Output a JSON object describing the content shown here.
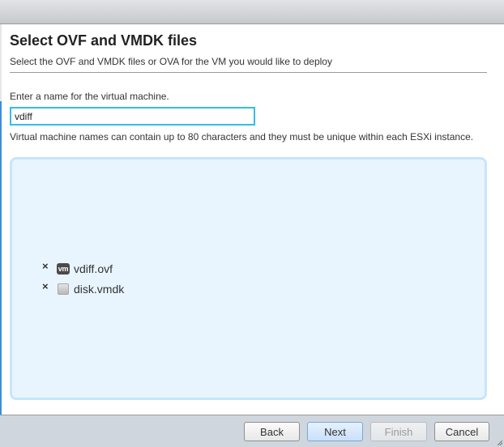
{
  "wizard": {
    "title": "Select OVF and VMDK files",
    "subtitle": "Select the OVF and VMDK files or OVA for the VM you would like to deploy"
  },
  "vm_name": {
    "label": "Enter a name for the virtual machine.",
    "value": "vdiff",
    "help": "Virtual machine names can contain up to 80 characters and they must be unique within each ESXi instance."
  },
  "files": [
    {
      "name": "vdiff.ovf",
      "icon": "vm-icon",
      "icon_text": "vm",
      "remove": "×"
    },
    {
      "name": "disk.vmdk",
      "icon": "disk-icon",
      "icon_text": "",
      "remove": "×"
    }
  ],
  "footer": {
    "back": "Back",
    "next": "Next",
    "finish": "Finish",
    "cancel": "Cancel"
  },
  "colors": {
    "input_focus": "#34bdea",
    "dropzone_bg": "#e8f5fe",
    "dropzone_border": "#c6e6fb",
    "accent_strip": "#3b8fd6"
  }
}
